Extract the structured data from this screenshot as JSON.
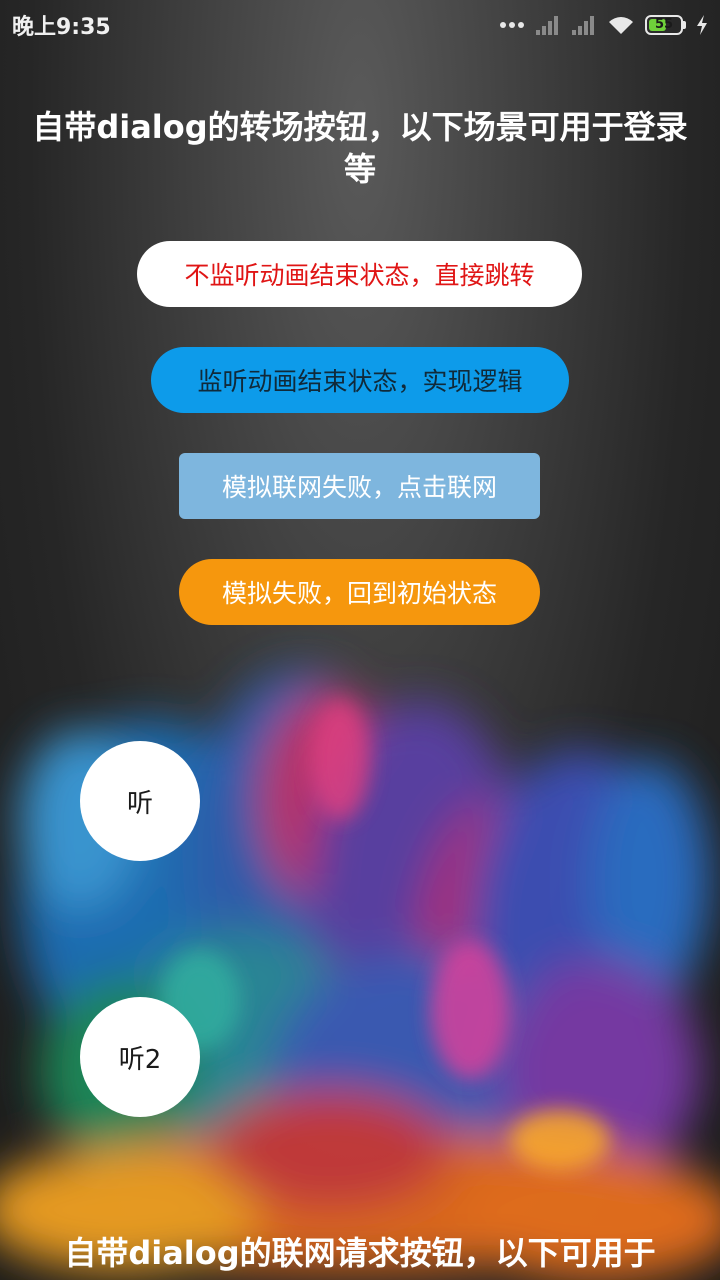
{
  "status_bar": {
    "time": "晚上9:35",
    "battery": "55",
    "battery_level": 0.55
  },
  "section1": {
    "title": "自带dialog的转场按钮，以下场景可用于登录等"
  },
  "buttons": [
    {
      "label": "不监听动画结束状态，直接跳转"
    },
    {
      "label": "监听动画结束状态，实现逻辑"
    },
    {
      "label": "模拟联网失败，点击联网"
    },
    {
      "label": "模拟失败，回到初始状态"
    }
  ],
  "circle_buttons": [
    {
      "label": "听"
    },
    {
      "label": "听2"
    }
  ],
  "section2": {
    "title": "自带dialog的联网请求按钮，以下可用于"
  },
  "colors": {
    "white_button_text": "#e01515",
    "blue_button": "#0d9bea",
    "light_blue_button": "#7eb6de",
    "orange_button": "#f6970d"
  }
}
